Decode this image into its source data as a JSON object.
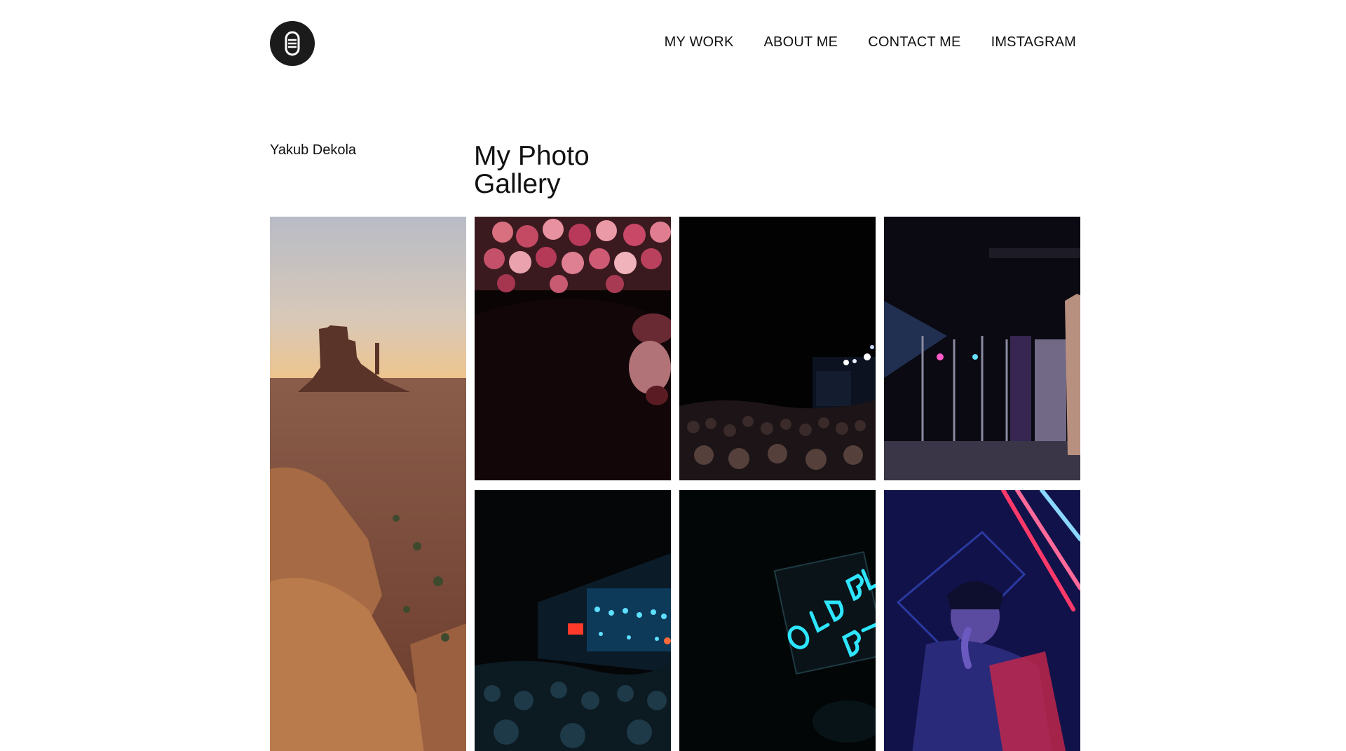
{
  "header": {
    "logo_icon": "microphone-icon",
    "nav": [
      {
        "label": "MY WORK"
      },
      {
        "label": "ABOUT ME"
      },
      {
        "label": "CONTACT ME"
      },
      {
        "label": "IMSTAGRAM"
      }
    ]
  },
  "intro": {
    "author": "Yakub Dekola",
    "title_line1": "My Photo",
    "title_line2": "Gallery"
  },
  "colors": {
    "text": "#111111",
    "background": "#ffffff",
    "logo_bg": "#1b1b1b"
  }
}
